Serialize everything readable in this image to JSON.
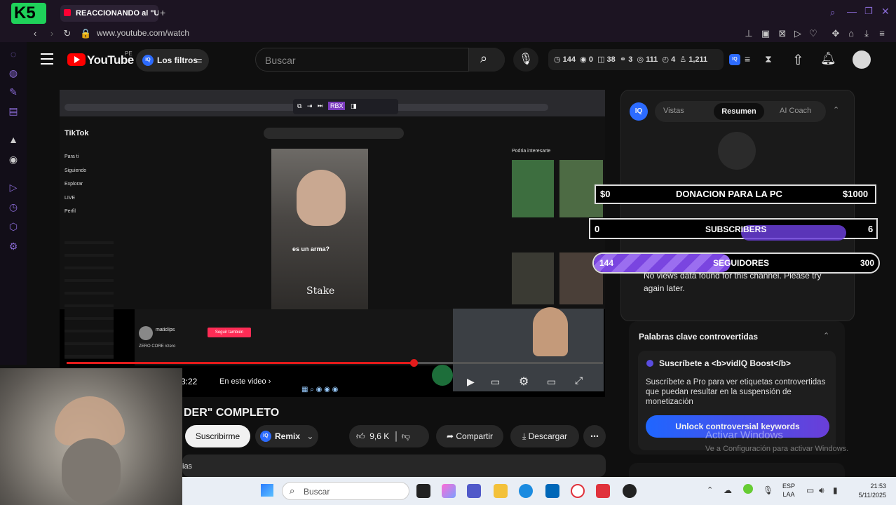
{
  "browser": {
    "tab_title": "REACCIONANDO al \"U",
    "channel_mark": "K5",
    "url": "www.youtube.com/watch"
  },
  "youtube": {
    "logo_text": "YouTube",
    "country": "PE",
    "filter_chip": "Los filtros",
    "search_placeholder": "Buscar",
    "stats": {
      "s1": "144",
      "s2": "0",
      "s3": "38",
      "s4": "3",
      "s5": "111",
      "s6": "4",
      "s7": "1,211"
    },
    "video_title": "DER\" COMPLETO",
    "subscribe_label": "Suscribirme",
    "remix_label": "Remix",
    "likes": "9,6 K",
    "share_label": "Compartir",
    "download_label": "Descargar",
    "time_label": "3:22",
    "in_video_label": "En este video",
    "desc_partial": "ias"
  },
  "inner": {
    "tiktok_label": "TikTok",
    "caption": "es un arma?",
    "may_interest": "Podria interesarte",
    "nav": [
      "Para ti",
      "Siguiendo",
      "Explorar",
      "LIVE",
      "Perfil"
    ],
    "follow_btn": "Seguir también",
    "user": "maticlips",
    "sound": "ZERO CORE #zero",
    "rbx": "RBX"
  },
  "right_panel": {
    "tabs": [
      "Vistas",
      "Resumen",
      "AI Coach"
    ],
    "no_data": "No views data found for this channel. Please try again later.",
    "keywords_title": "Palabras clave controvertidas",
    "boost_line": "Suscríbete a <b>vidIQ Boost</b>",
    "boost_desc": "Suscríbete a Pro para ver etiquetas controvertidas que puedan resultar en la suspensión de monetización",
    "unlock_label": "Unlock controversial keywords",
    "activate": "Activar Windows",
    "activate_sub": "Ve a Configuración para activar Windows."
  },
  "overlays": {
    "donation": {
      "left": "$0",
      "title": "DONACION PARA LA PC",
      "right": "$1000"
    },
    "subscribers": {
      "left": "0",
      "title": "SUBSCRIBERS",
      "right": "6",
      "progress": 0.0
    },
    "followers": {
      "left": "144",
      "title": "SEGUIDORES",
      "right": "300",
      "progress": 0.48
    }
  },
  "taskbar": {
    "search": "Buscar",
    "lang1": "ESP",
    "lang2": "LAA",
    "time": "21:53",
    "date": "5/11/2025"
  }
}
